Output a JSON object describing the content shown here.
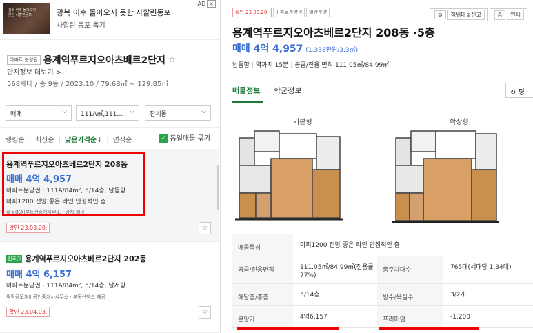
{
  "ad": {
    "thumb_text": "광복 이후 돌아오지 못한 사할린동포",
    "title": "광복 이후 돌아오지 못한 사할린동포",
    "subtitle": "사할린 동포 돕기",
    "ad_label": "AD"
  },
  "complex": {
    "type_tag": "아파트 분양권",
    "name": "용계역푸르지오아츠베르2단지",
    "more_link": "단지정보 더보기",
    "summary": "568세대 / 총 9동 / 2023.10 / 79.68㎡ ~ 129.85㎡"
  },
  "filters": {
    "trade_type": "매매",
    "area": "111A㎡,111…",
    "dong": "전체동"
  },
  "sort": {
    "options": [
      "랭킹순",
      "최신순",
      "낮은가격순↓",
      "면적순"
    ],
    "same_listing_label": "동일매물 묶기"
  },
  "listings": [
    {
      "title": "용계역푸르지오아츠베르2단지 208동",
      "price": "매매 4억 4,957",
      "spec": "아파트분양권 · 111A/84m², 5/14층, 남동향",
      "desc": "마피1200 전망 좋은 라인 안정적인 층",
      "broker": "확실(KA)부동산중개사무소 · 왕자 제공",
      "confirmed": "확인 23.03.20."
    },
    {
      "owner_tag": "집주인",
      "title": "용계역푸르지오아츠베르2단지 202동",
      "price": "매매 4억 6,157",
      "spec": "아파트분양권 · 111A/84m², 5/14층, 남서향",
      "broker": "뚝딱금도개비공인중개사사무소 · 부동산뱅크 제공",
      "confirmed": "확인 23.04.03."
    }
  ],
  "detail": {
    "tags": [
      "확인 23.03.20.",
      "아파트분양권",
      "일반분양"
    ],
    "tools": [
      "허위매물신고",
      "인쇄"
    ],
    "title": "용계역푸르지오아츠베르2단지 208동 ·5층",
    "price": "매매 4억 4,957",
    "price_per": "(1,338만원/3.3㎡)",
    "info": [
      "남동향",
      "역까지 15분",
      "공급/전용 면적:111.05㎡/84.99㎡"
    ],
    "tabs": [
      "매물정보",
      "학군정보"
    ],
    "tab_button": "평",
    "plans": [
      "기본형",
      "확장형"
    ],
    "rows": [
      {
        "k": "매물특징",
        "v": "마피1200 전망 좋은 라인 안정적인 층"
      },
      {
        "k": "공급/전용면적",
        "v": "111.05㎡/84.99㎡(전용률77%)",
        "k2": "총주차대수",
        "v2": "765대(세대당 1.34대)"
      },
      {
        "k": "해당층/총층",
        "v": "5/14층",
        "k2": "방수/욕실수",
        "v2": "3/2개"
      },
      {
        "k": "분양가",
        "v": "4억6,157",
        "k2": "프리미엄",
        "v2": "-1,200"
      }
    ]
  },
  "colors": {
    "accent_green": "#1e7a3c",
    "price_blue": "#3c6fd6",
    "highlight_red": "#e00000"
  }
}
